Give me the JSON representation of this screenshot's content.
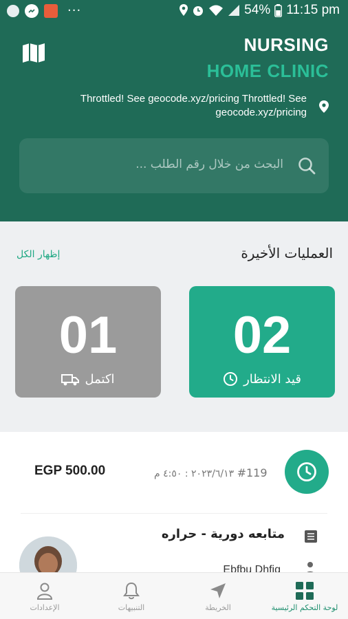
{
  "status_bar": {
    "battery": "54%",
    "time": "11:15 pm",
    "more": "···"
  },
  "header": {
    "brand_line1": "NURSING",
    "brand_line2": "HOME CLINIC",
    "address": "Throttled! See geocode.xyz/pricing Throttled! See geocode.xyz/pricing",
    "search_placeholder": "البحث من خلال رقم الطلب ..."
  },
  "recent": {
    "title": "العمليات الأخيرة",
    "show_all": "إظهار الكل",
    "cards": [
      {
        "count": "02",
        "label": "قيد الانتظار"
      },
      {
        "count": "01",
        "label": "اكتمل"
      }
    ]
  },
  "order": {
    "id": "#119",
    "date": "٢٠٢٣/٦/١٣ : ٤:٥٠ م",
    "price": "EGP 500.00",
    "service": "متابعه دورية - حراره",
    "patient": "Ebfbu Dhfiq"
  },
  "nav": {
    "dashboard": "لوحة التحكم الرئيسية",
    "map": "الخريطة",
    "notifications": "التنبيهات",
    "settings": "الإعدادات"
  },
  "colors": {
    "header_bg": "#1f6b57",
    "accent": "#22ab8a",
    "brand_accent": "#2bbf98",
    "completed_card": "#9b9b9b"
  }
}
